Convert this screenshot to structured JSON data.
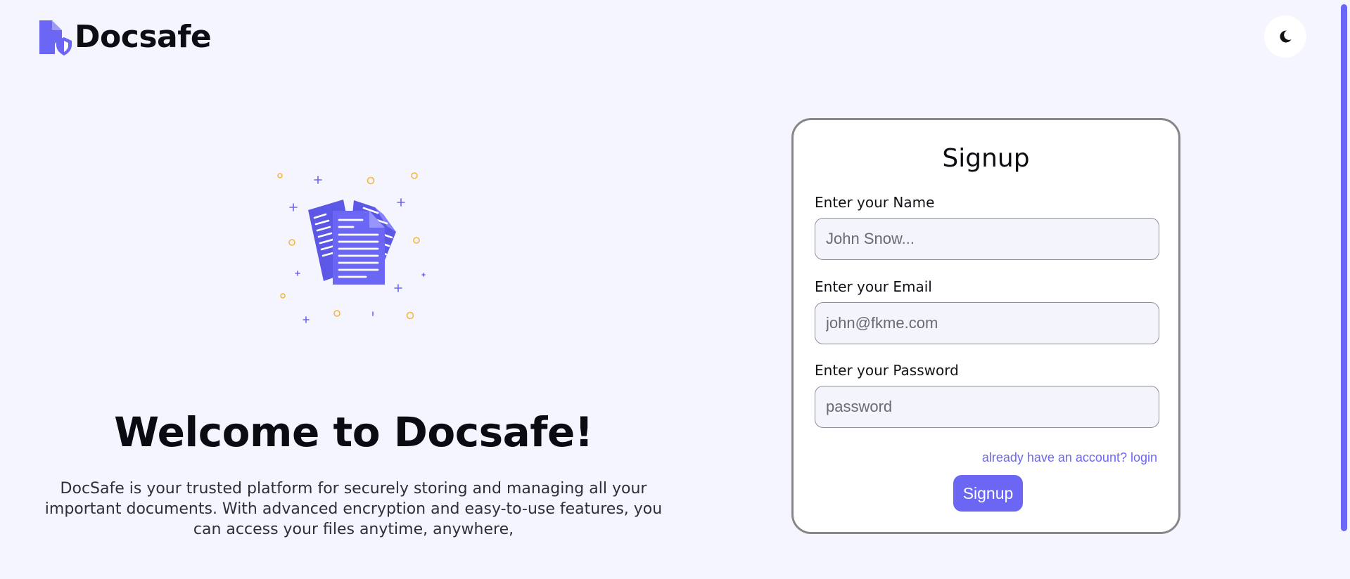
{
  "brand": {
    "name": "Docsafe",
    "logo_icon": "secure-document-icon"
  },
  "header": {
    "theme_toggle_icon": "moon-icon"
  },
  "hero": {
    "illustration": "documents-illustration",
    "title": "Welcome to Docsafe!",
    "description": "DocSafe is your trusted platform for securely storing and managing all your important documents. With advanced encryption and easy-to-use features, you can access your files anytime, anywhere,"
  },
  "signup": {
    "title": "Signup",
    "fields": {
      "name": {
        "label": "Enter your Name",
        "placeholder": "John Snow...",
        "value": ""
      },
      "email": {
        "label": "Enter your Email",
        "placeholder": "john@fkme.com",
        "value": ""
      },
      "password": {
        "label": "Enter your Password",
        "placeholder": "password",
        "value": ""
      }
    },
    "login_link": "already have an account? login",
    "submit_label": "Signup"
  },
  "colors": {
    "accent": "#6b66f3",
    "background": "#f5f5ff",
    "card_border": "#878787",
    "text": "#0b0b12"
  }
}
